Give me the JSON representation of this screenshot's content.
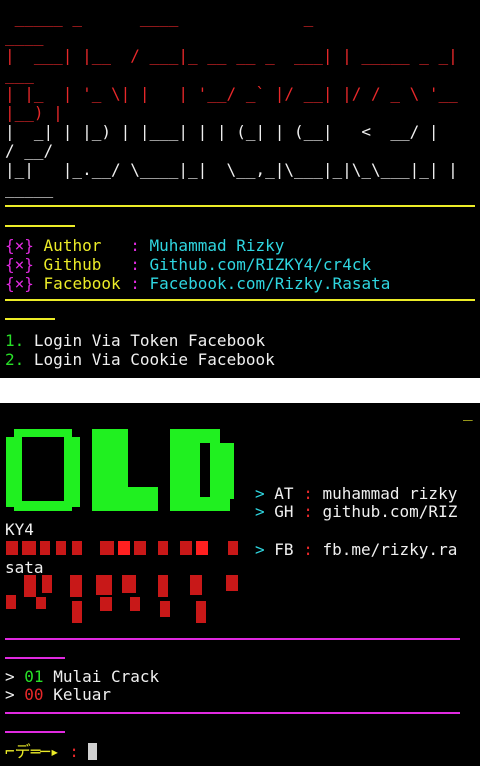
{
  "banner1": {
    "ascii": [
      " _____ _      ____             _",
      "____",
      "|  ___| |__  / ___|_ __ __ _  ___| | _____ _ _|",
      "___",
      "| |_  | '_ \\| |   | '__/ _` |/ __| |/ / _ \\ '__",
      "|__) |",
      "|  _| | |_) | |___| | | (_| | (__|   <  __/ |",
      "/ __/",
      "|_|   |_.__/ \\____|_|  \\__,_|\\___|_|\\_\\___|_| |",
      "_____"
    ],
    "info": [
      {
        "mark": "{×}",
        "key": "Author  ",
        "sep": ":",
        "value": "Muhammad Rizky"
      },
      {
        "mark": "{×}",
        "key": "Github  ",
        "sep": ":",
        "value": "Github.com/RIZKY4/cr4ck"
      },
      {
        "mark": "{×}",
        "key": "Facebook",
        "sep": ":",
        "value": "Facebook.com/Rizky.Rasata"
      }
    ],
    "menu": [
      {
        "num": "1.",
        "label": "Login Via Token Facebook"
      },
      {
        "num": "2.",
        "label": "Login Via Cookie Facebook"
      }
    ]
  },
  "banner2": {
    "logo": "OLD",
    "contact": [
      {
        "arrow": ">",
        "key": "AT",
        "sep": ":",
        "value": "muhammad rizky"
      },
      {
        "arrow": ">",
        "key": "GH",
        "sep": ":",
        "value": "github.com/RIZ"
      },
      {
        "arrow": ">",
        "key": "FB",
        "sep": ":",
        "value": "fb.me/rizky.ra"
      }
    ],
    "wrap1": "KY4",
    "wrap2": "sata",
    "menu": [
      {
        "arrow": ">",
        "num": "01",
        "label": "Mulai Crack"
      },
      {
        "arrow": ">",
        "num": "00",
        "label": "Keluar"
      }
    ],
    "prompt_symbol": "⌐デ═─▸",
    "prompt_sep": ":"
  },
  "colors": {
    "red": "#e8282a",
    "yellow": "#ecec28",
    "cyan": "#2fd6e0",
    "magenta": "#e02ae0",
    "green": "#28e028"
  }
}
